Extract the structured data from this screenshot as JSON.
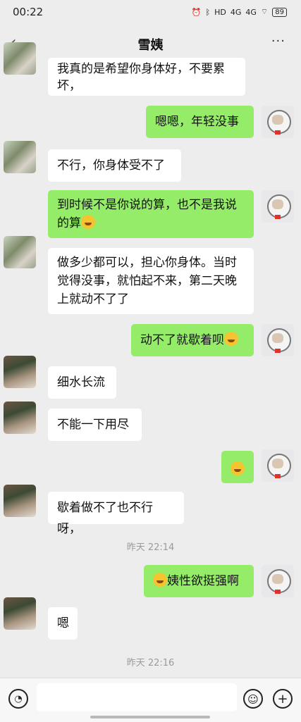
{
  "status": {
    "time": "00:22",
    "icons": [
      "alarm-icon",
      "bluetooth-icon",
      "hd-icon",
      "4g-icon",
      "4g-icon",
      "wifi-icon"
    ],
    "battery": "89"
  },
  "chat": {
    "title": "雪姨",
    "back_icon": "‹",
    "more_icon": "···"
  },
  "messages": [
    {
      "side": "left",
      "text": "我真的是希望你身体好，不要累坏，"
    },
    {
      "side": "right",
      "text": "嗯嗯，年轻没事"
    },
    {
      "side": "left",
      "text": "不行，你身体受不了"
    },
    {
      "side": "right",
      "text": "到时候不是你说的算，也不是我说的算"
    },
    {
      "side": "left",
      "text": "做多少都可以，担心你身体。当时觉得没事，就怕起不来，第二天晚上就动不了了"
    },
    {
      "side": "right",
      "text": "动不了就歇着呗"
    },
    {
      "side": "left",
      "text": "细水长流"
    },
    {
      "side": "left",
      "text": "不能一下用尽"
    },
    {
      "side": "right",
      "text": ""
    },
    {
      "side": "left",
      "text": "歇着做不了也不行呀，"
    },
    {
      "side": "right",
      "text": "姨性欲挺强啊"
    },
    {
      "side": "left",
      "text": "嗯"
    }
  ],
  "timestamps": [
    "昨天 22:14",
    "昨天 22:16"
  ],
  "inputbar": {
    "voice_icon": "voice-icon",
    "emoji_icon": "emoji-icon",
    "plus_icon": "+"
  }
}
